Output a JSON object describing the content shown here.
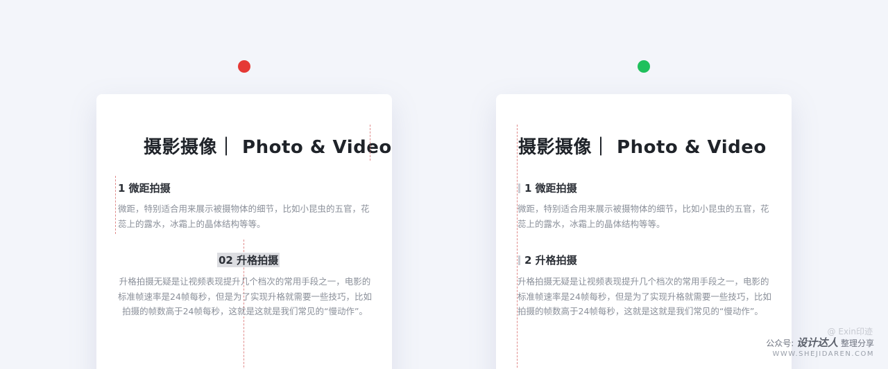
{
  "colors": {
    "bad": "#e53935",
    "good": "#20c05c",
    "guide": "#e08a8a"
  },
  "cards": {
    "left": {
      "title": "摄影摄像｜ Photo & Video",
      "section1": {
        "heading": "1 微距拍摄",
        "body": "微距，特别适合用来展示被摄物体的细节，比如小昆虫的五官，花蕊上的露水，冰霜上的晶体结构等等。"
      },
      "section2": {
        "heading": "02 升格拍摄",
        "body": "升格拍摄无疑是让视频表现提升几个档次的常用手段之一，电影的标准帧速率是24帧每秒，但是为了实现升格就需要一些技巧，比如拍摄的帧数高于24帧每秒，这就是这就是我们常见的“慢动作”。"
      }
    },
    "right": {
      "title": "摄影摄像｜ Photo & Video",
      "section1": {
        "heading": "1 微距拍摄",
        "body": "微距，特别适合用来展示被摄物体的细节，比如小昆虫的五官，花蕊上的露水，冰霜上的晶体结构等等。"
      },
      "section2": {
        "heading": "2 升格拍摄",
        "body": "升格拍摄无疑是让视频表现提升几个档次的常用手段之一，电影的标准帧速率是24帧每秒，但是为了实现升格就需要一些技巧，比如拍摄的帧数高于24帧每秒，这就是这就是我们常见的“慢动作”。"
      }
    }
  },
  "watermark": "@ Exin印迹",
  "badge": {
    "prefix": "公众号:",
    "brand": "设计达人",
    "suffix": "整理分享",
    "url": "WWW.SHEJIDAREN.COM"
  }
}
